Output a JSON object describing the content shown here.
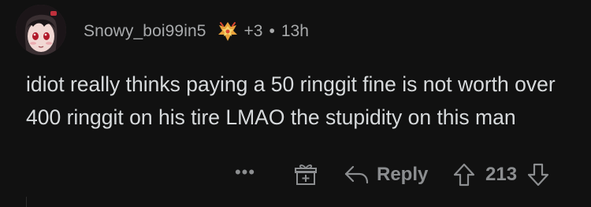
{
  "comment": {
    "username": "Snowy_boi99in5",
    "award_icon": "award-icon",
    "award_count": "+3",
    "separator": "•",
    "time": "13h",
    "body": "idiot really thinks paying a 50 ringgit fine is not worth over 400 ringgit on his tire LMAO the stupidity on this man"
  },
  "actions": {
    "more_label": "•••",
    "gift_icon": "gift-icon",
    "reply_label": "Reply",
    "upvote_icon": "upvote-arrow-icon",
    "score": "213",
    "downvote_icon": "downvote-arrow-icon"
  },
  "colors": {
    "background": "#111111",
    "body_text": "#d7dadc",
    "meta_text": "#a8aaab",
    "action_gray": "#8c8e90"
  }
}
